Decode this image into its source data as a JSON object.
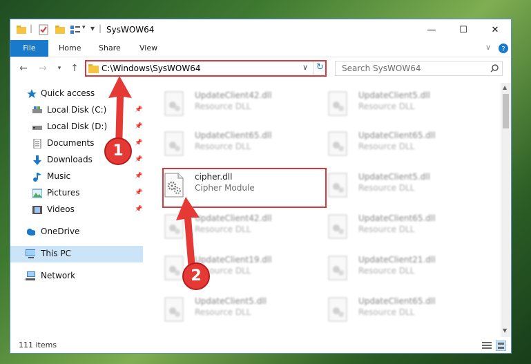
{
  "window": {
    "title": "SysWOW64",
    "controls": {
      "minimize": "—",
      "maximize": "☐",
      "close": "✕"
    }
  },
  "ribbon": {
    "tabs": [
      "File",
      "Home",
      "Share",
      "View"
    ]
  },
  "address": {
    "path": "C:\\Windows\\SysWOW64",
    "search_placeholder": "Search SysWOW64"
  },
  "sidebar": {
    "items": [
      {
        "label": "Quick access",
        "icon": "star-icon"
      },
      {
        "label": "Local Disk (C:)",
        "icon": "drive-icon",
        "pinned": true
      },
      {
        "label": "Local Disk (D:)",
        "icon": "drive-icon",
        "pinned": true
      },
      {
        "label": "Documents",
        "icon": "documents-icon",
        "pinned": true
      },
      {
        "label": "Downloads",
        "icon": "downloads-icon",
        "pinned": true
      },
      {
        "label": "Music",
        "icon": "music-icon",
        "pinned": true
      },
      {
        "label": "Pictures",
        "icon": "pictures-icon",
        "pinned": true
      },
      {
        "label": "Videos",
        "icon": "videos-icon",
        "pinned": true
      },
      {
        "label": "OneDrive",
        "icon": "cloud-icon"
      },
      {
        "label": "This PC",
        "icon": "computer-icon",
        "selected": true
      },
      {
        "label": "Network",
        "icon": "network-icon"
      }
    ]
  },
  "files": [
    {
      "name": "UpdateClient42.dll",
      "desc": "Resource DLL"
    },
    {
      "name": "UpdateClient5.dll",
      "desc": "Resource DLL"
    },
    {
      "name": "UpdateClient65.dll",
      "desc": "Resource DLL"
    },
    {
      "name": "UpdateClient65.dll",
      "desc": "Resource DLL"
    },
    {
      "name": "cipher.dll",
      "desc": "Cipher Module",
      "highlighted": true
    },
    {
      "name": "UpdateClient5.dll",
      "desc": "Resource DLL"
    },
    {
      "name": "UpdateClient42.dll",
      "desc": "Resource DLL"
    },
    {
      "name": "UpdateClient65.dll",
      "desc": "Resource DLL"
    },
    {
      "name": "UpdateClient19.dll",
      "desc": "Resource DLL"
    },
    {
      "name": "UpdateClient21.dll",
      "desc": "Resource DLL"
    },
    {
      "name": "UpdateClient5.dll",
      "desc": "Resource DLL"
    },
    {
      "name": "UpdateClient65.dll",
      "desc": "Resource DLL"
    }
  ],
  "status": {
    "item_count": "111 items"
  },
  "annotations": [
    {
      "number": "1"
    },
    {
      "number": "2"
    }
  ],
  "colors": {
    "accent": "#1979ca",
    "highlight": "#d9373a",
    "selected": "#cce4f7"
  }
}
